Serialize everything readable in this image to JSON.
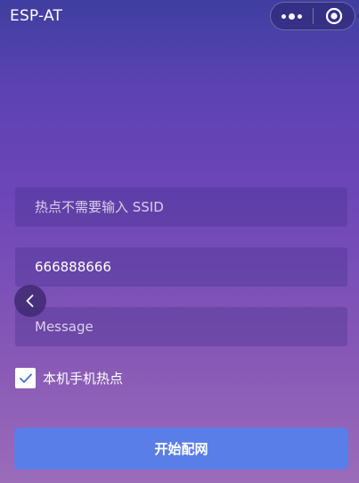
{
  "app": {
    "title": "ESP-AT"
  },
  "capsule": {
    "more_icon": "more-dots-icon",
    "close_icon": "target-close-icon"
  },
  "form": {
    "ssid_placeholder": "热点不需要输入 SSID",
    "ssid_value": "",
    "password_value": "666888666",
    "message_placeholder": "Message",
    "message_value": "",
    "hotspot_checkbox_label": "本机手机热点",
    "hotspot_checked": true,
    "submit_label": "开始配网"
  },
  "colors": {
    "gradient_top": "#3f3ea0",
    "gradient_bottom": "#9b6cb8",
    "submit_button": "#5a7ee8",
    "check_mark": "#4a6fd6"
  }
}
